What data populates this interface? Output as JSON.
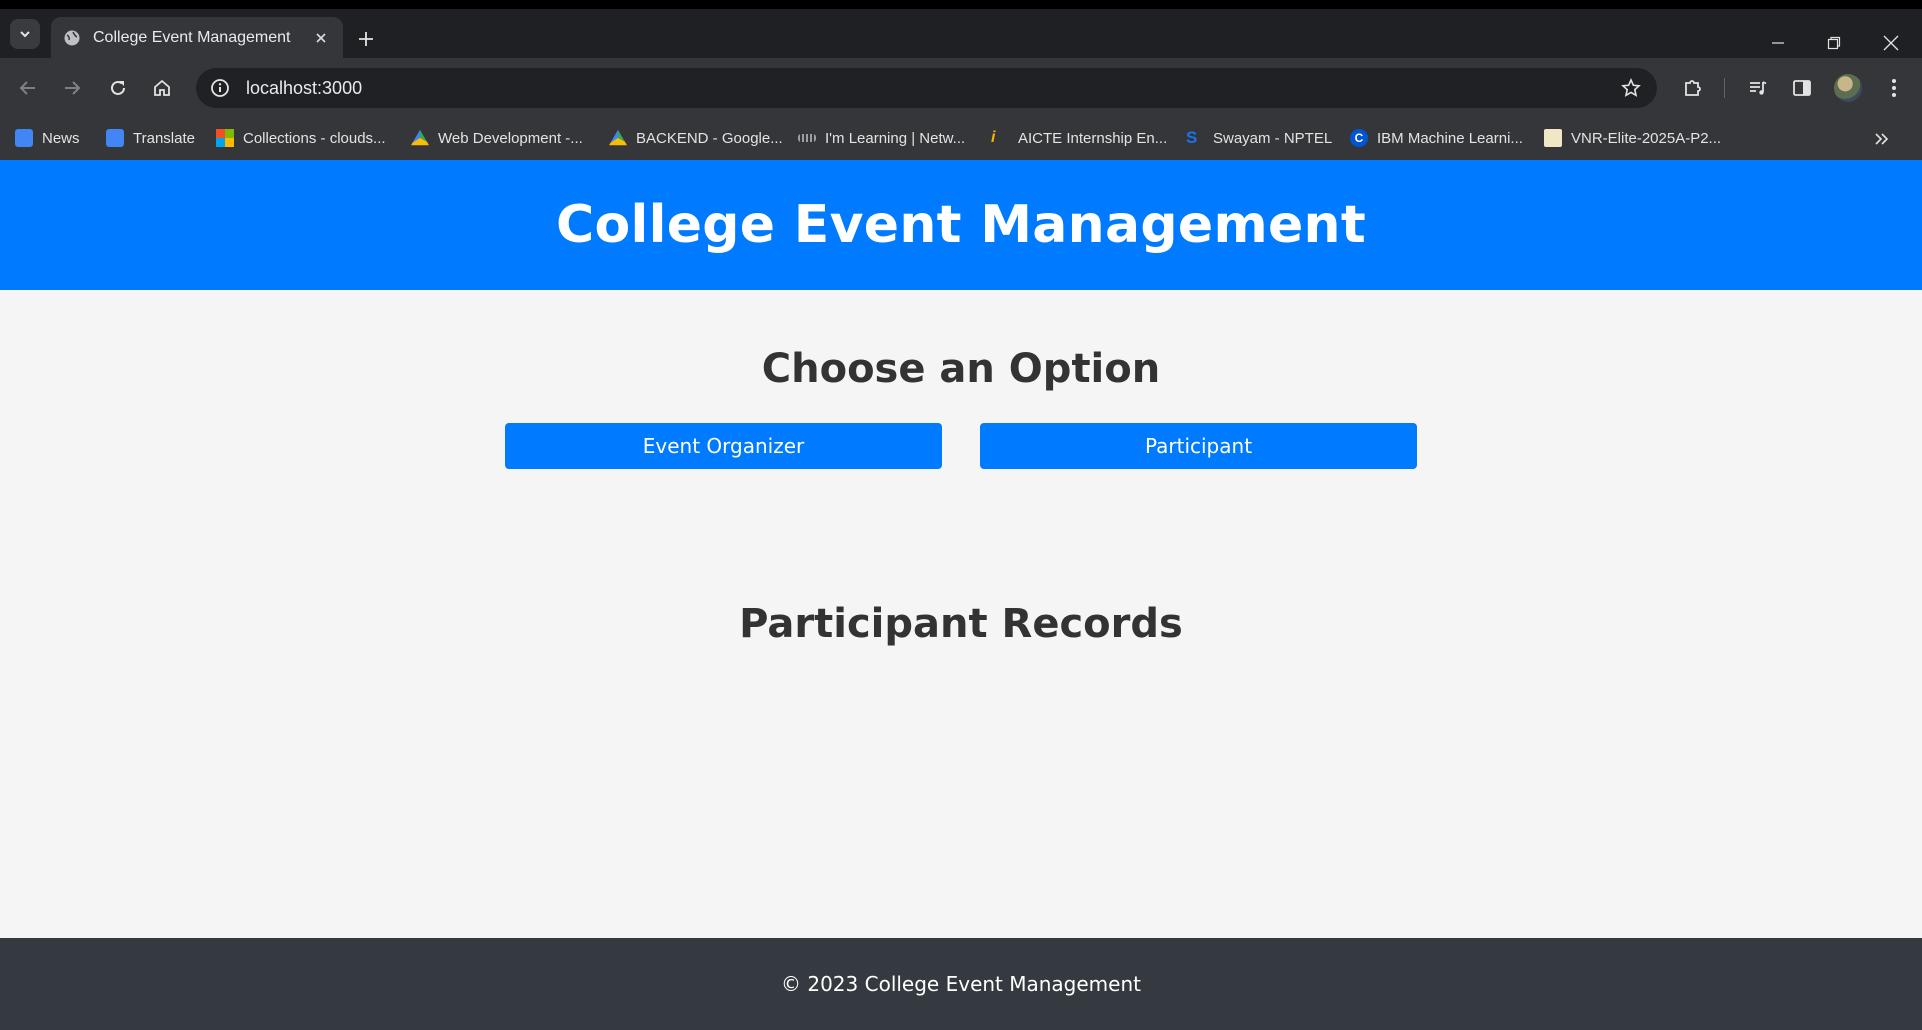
{
  "browser": {
    "tab": {
      "title": "College Event Management"
    },
    "address_bar": {
      "url": "localhost:3000"
    },
    "bookmarks": [
      {
        "label": "News",
        "icon": "google-news-icon",
        "color": "#4285f4"
      },
      {
        "label": "Translate",
        "icon": "google-translate-icon",
        "color": "#4285f4"
      },
      {
        "label": "Collections - clouds...",
        "icon": "microsoft-icon",
        "color": "#f25022"
      },
      {
        "label": "Web Development -...",
        "icon": "google-drive-icon",
        "color": "#34a853"
      },
      {
        "label": "BACKEND - Google...",
        "icon": "google-drive-icon",
        "color": "#34a853"
      },
      {
        "label": "I'm Learning | Netw...",
        "icon": "cisco-icon",
        "color": "#9aa0a6"
      },
      {
        "label": "AICTE Internship En...",
        "icon": "aicte-icon",
        "color": "#f4b400"
      },
      {
        "label": "Swayam - NPTEL",
        "icon": "swayam-icon",
        "color": "#1a73e8"
      },
      {
        "label": "IBM Machine Learni...",
        "icon": "coursera-icon",
        "color": "#0056d2"
      },
      {
        "label": "VNR-Elite-2025A-P2...",
        "icon": "vnr-icon",
        "color": "#f1e7c4"
      }
    ]
  },
  "header": {
    "title": "College Event Management"
  },
  "options": {
    "title": "Choose an Option",
    "organizer_label": "Event Organizer",
    "participant_label": "Participant"
  },
  "records": {
    "title": "Participant Records"
  },
  "footer": {
    "text": "© 2023 College Event Management"
  },
  "colors": {
    "primary": "#007bff",
    "footer_bg": "#343a40",
    "page_bg": "#f5f5f5"
  }
}
